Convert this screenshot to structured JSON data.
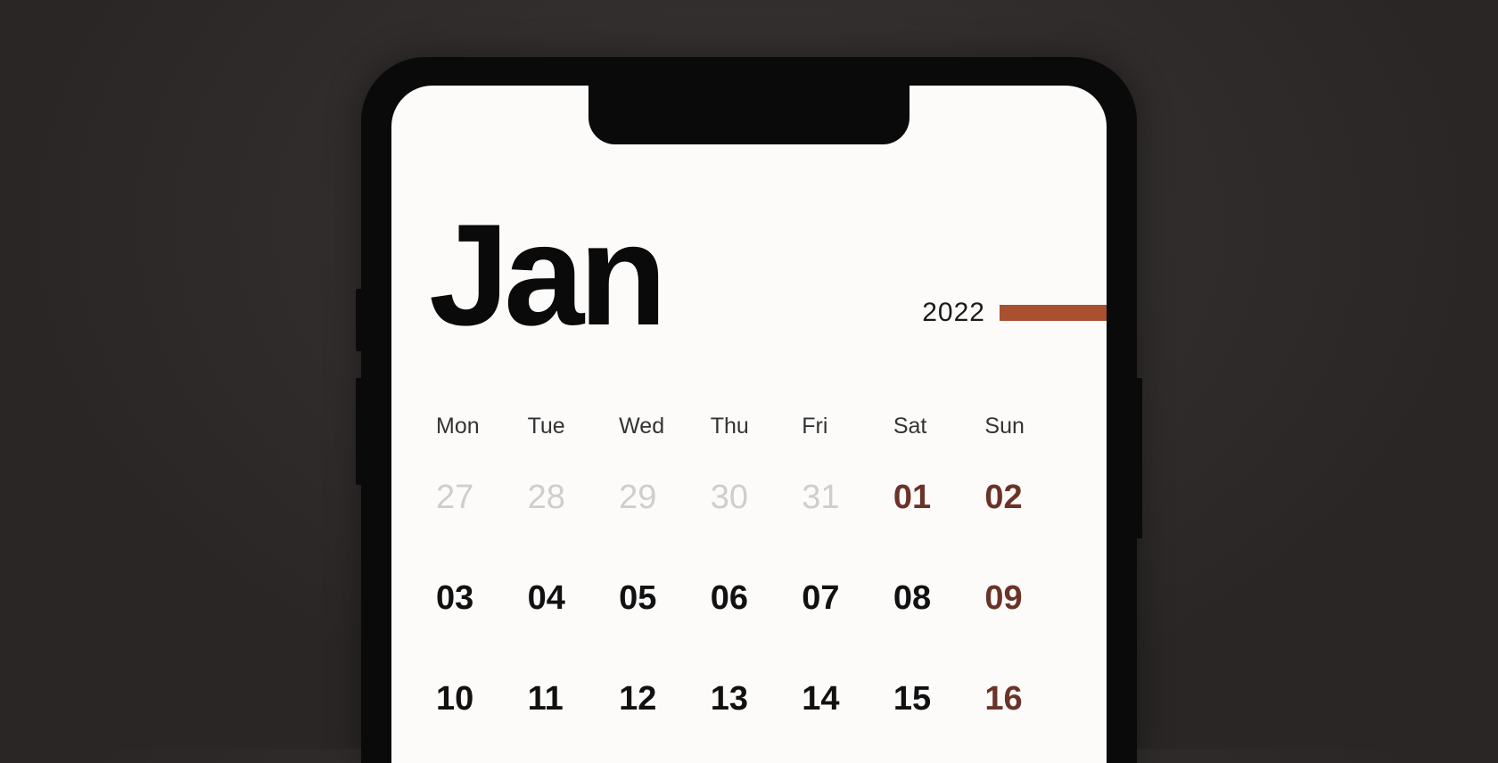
{
  "calendar": {
    "month_label": "Jan",
    "year_label": "2022",
    "weekdays": [
      "Mon",
      "Tue",
      "Wed",
      "Thu",
      "Fri",
      "Sat",
      "Sun"
    ],
    "rows": [
      [
        {
          "d": "27",
          "muted": true,
          "weekend": false
        },
        {
          "d": "28",
          "muted": true,
          "weekend": false
        },
        {
          "d": "29",
          "muted": true,
          "weekend": false
        },
        {
          "d": "30",
          "muted": true,
          "weekend": false
        },
        {
          "d": "31",
          "muted": true,
          "weekend": false
        },
        {
          "d": "01",
          "muted": false,
          "weekend": true
        },
        {
          "d": "02",
          "muted": false,
          "weekend": true
        }
      ],
      [
        {
          "d": "03",
          "muted": false,
          "weekend": false
        },
        {
          "d": "04",
          "muted": false,
          "weekend": false
        },
        {
          "d": "05",
          "muted": false,
          "weekend": false
        },
        {
          "d": "06",
          "muted": false,
          "weekend": false
        },
        {
          "d": "07",
          "muted": false,
          "weekend": false
        },
        {
          "d": "08",
          "muted": false,
          "weekend": false
        },
        {
          "d": "09",
          "muted": false,
          "weekend": true
        }
      ],
      [
        {
          "d": "10",
          "muted": false,
          "weekend": false
        },
        {
          "d": "11",
          "muted": false,
          "weekend": false
        },
        {
          "d": "12",
          "muted": false,
          "weekend": false
        },
        {
          "d": "13",
          "muted": false,
          "weekend": false
        },
        {
          "d": "14",
          "muted": false,
          "weekend": false
        },
        {
          "d": "15",
          "muted": false,
          "weekend": false
        },
        {
          "d": "16",
          "muted": false,
          "weekend": true
        }
      ]
    ],
    "accent_color": "#a8502f"
  }
}
